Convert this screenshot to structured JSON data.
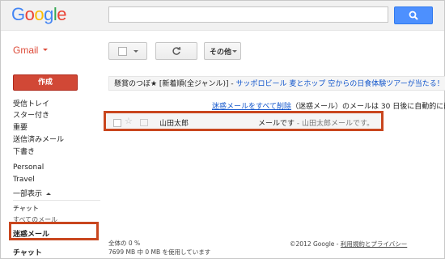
{
  "header": {
    "logo_letters": [
      "G",
      "o",
      "o",
      "g",
      "l",
      "e"
    ],
    "search_placeholder": "",
    "search_icon": "search-icon"
  },
  "toolbar": {
    "gmail_label": "Gmail",
    "more_label": "その他"
  },
  "sidebar": {
    "compose_label": "作成",
    "items": [
      {
        "label": "受信トレイ"
      },
      {
        "label": "スター付き"
      },
      {
        "label": "重要"
      },
      {
        "label": "送信済みメール"
      },
      {
        "label": "下書き"
      },
      {
        "label": "Personal"
      },
      {
        "label": "Travel"
      },
      {
        "label": "一部表示"
      },
      {
        "label": "チャット"
      },
      {
        "label": "すべてのメール"
      },
      {
        "label": "迷惑メール"
      },
      {
        "label": "チャット"
      }
    ]
  },
  "main": {
    "webclip_source": "懸賞のつぼ★ [新着順(全ジャンル)]",
    "webclip_sep": " - ",
    "webclip_ad": "サッポロビール 麦とホップ 空からの日食体験ツアーが当たる！ -",
    "notice_link": "迷惑メールをすべて削除",
    "notice_text": "（迷惑メール）のメールは 30 日後に自動的に削",
    "message": {
      "sender": "山田太郎",
      "subject": "メールです",
      "snippet": " - 山田太郎メールです。"
    }
  },
  "footer": {
    "usage_title": "全体の 0 %",
    "usage_detail": "7699 MB 中 0 MB を使用しています",
    "copyright": "©2012 Google - ",
    "terms": "利用規約とプライバシー"
  },
  "colors": {
    "accent_red": "#dd4b39",
    "compose_red": "#d14836",
    "highlight_box": "#c9461e",
    "search_blue": "#4d90fe",
    "link_blue": "#1155cc"
  }
}
